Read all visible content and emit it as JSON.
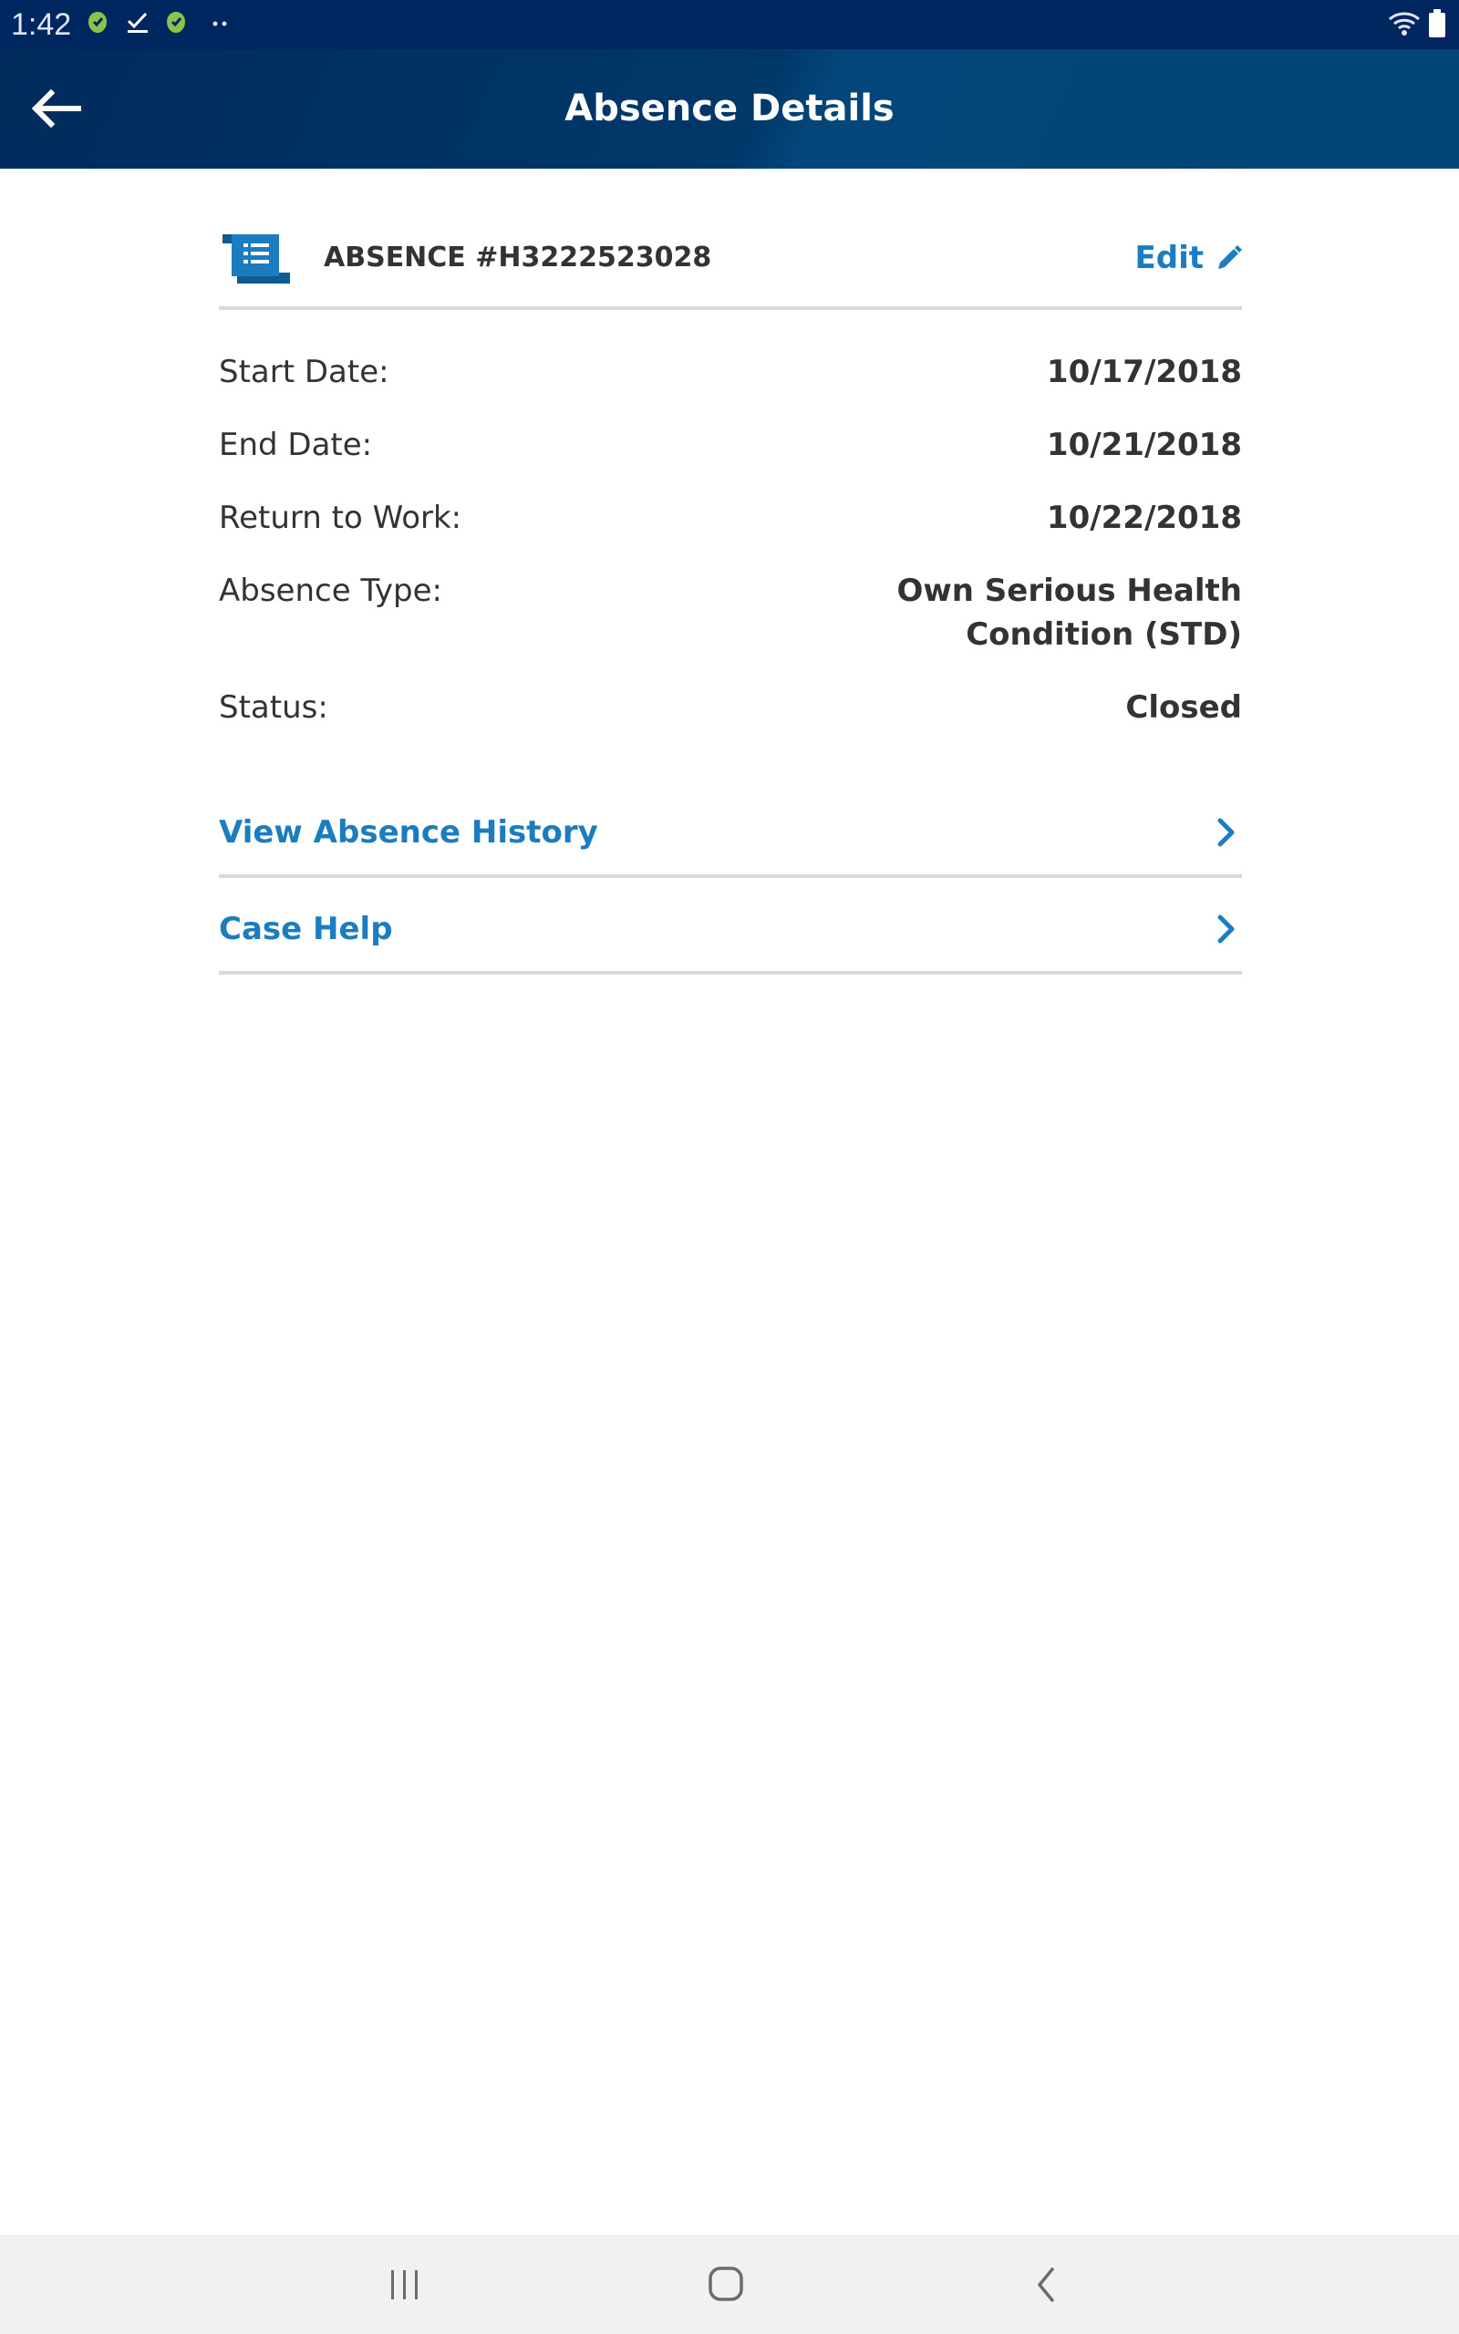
{
  "status_bar": {
    "time": "1:42"
  },
  "header": {
    "title": "Absence Details",
    "back_icon": "arrow-left-icon"
  },
  "absence": {
    "number": "ABSENCE #H3222523028",
    "icon": "document-scroll-icon",
    "edit_label": "Edit",
    "edit_icon": "pencil-icon"
  },
  "details": {
    "start_date": {
      "label": "Start Date:",
      "value": "10/17/2018"
    },
    "end_date": {
      "label": "End Date:",
      "value": "10/21/2018"
    },
    "return_to_work": {
      "label": "Return to Work:",
      "value": "10/22/2018"
    },
    "absence_type": {
      "label": "Absence Type:",
      "value": "Own Serious Health Condition (STD)"
    },
    "status": {
      "label": "Status:",
      "value": "Closed"
    }
  },
  "links": {
    "view_absence_history": "View Absence History",
    "case_help": "Case Help"
  },
  "colors": {
    "status_bar": "#00265f",
    "header": "#003a6b",
    "link": "#1b7dbf",
    "divider": "#d9d9d9",
    "nav_bar": "#f1f1f1"
  }
}
